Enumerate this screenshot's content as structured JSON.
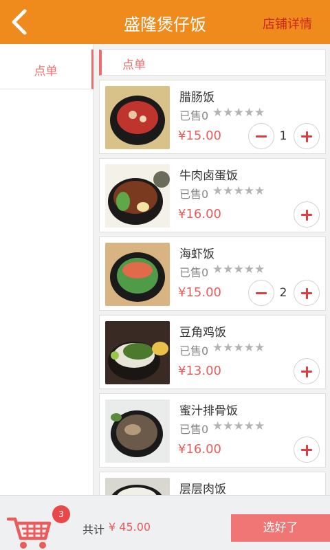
{
  "header": {
    "title": "盛隆煲仔饭",
    "store_details": "店铺详情"
  },
  "sidebar": {
    "items": [
      {
        "label": "点单"
      }
    ]
  },
  "section": {
    "title": "点单"
  },
  "dishes": [
    {
      "name": "腊肠饭",
      "sold": "已售0",
      "stars": "★★★★★",
      "price": "¥15.00",
      "qty": "1",
      "has_minus": true
    },
    {
      "name": "牛肉卤蛋饭",
      "sold": "已售0",
      "stars": "★★★★★",
      "price": "¥16.00",
      "qty": "",
      "has_minus": false
    },
    {
      "name": "海虾饭",
      "sold": "已售0",
      "stars": "★★★★★",
      "price": "¥15.00",
      "qty": "2",
      "has_minus": true
    },
    {
      "name": "豆角鸡饭",
      "sold": "已售0",
      "stars": "★★★★★",
      "price": "¥13.00",
      "qty": "",
      "has_minus": false
    },
    {
      "name": "蜜汁排骨饭",
      "sold": "已售0",
      "stars": "★★★★★",
      "price": "¥16.00",
      "qty": "",
      "has_minus": false
    },
    {
      "name": "层层肉饭",
      "sold": "",
      "stars": "",
      "price": "",
      "qty": "",
      "has_minus": false
    }
  ],
  "footer": {
    "cart_count": "3",
    "total_label": "共计",
    "total_value": "¥ 45.00",
    "confirm_label": "选好了"
  },
  "colors": {
    "header": "#ef8a1c",
    "accent": "#ef6b6b",
    "price": "#e85c5c",
    "button": "#f07676"
  }
}
